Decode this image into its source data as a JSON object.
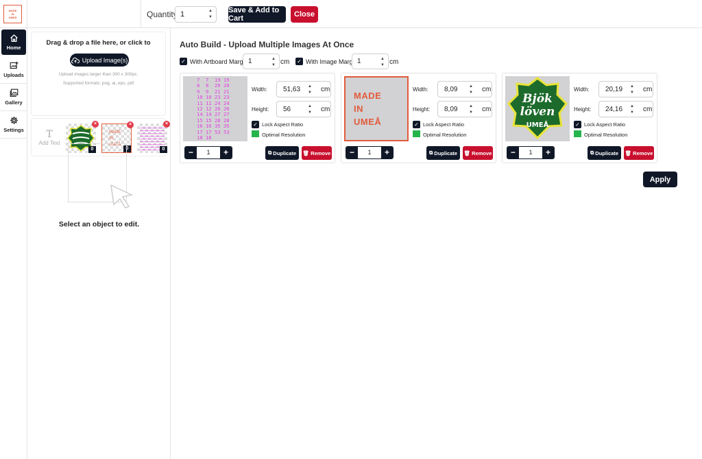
{
  "logo_text": [
    "MADE",
    "IN",
    "UMEÅ"
  ],
  "topbar": {
    "quantity_label": "Quantity:",
    "quantity_value": "1",
    "save_label": "Save & Add to Cart",
    "close_label": "Close"
  },
  "nav": {
    "home": "Home",
    "uploads": "Uploads",
    "gallery": "Gallery",
    "settings": "Settings"
  },
  "upload": {
    "drag_text": "Drag & drop a file here, or click to",
    "button_label": "Upload Image(s)",
    "hint_size": "Upload images larger than 300 x 300px.",
    "hint_formats": "Supported formats: png, ai, eps, pdf"
  },
  "thumbs": {
    "add_text": "Add Text",
    "t_icon": "T",
    "items": [
      {
        "count": "0",
        "text": ""
      },
      {
        "count": "0",
        "text": "MADE\nIN\nUMEÅ"
      },
      {
        "count": "0",
        "text": ""
      }
    ]
  },
  "editor": {
    "select_text": "Select an object to edit."
  },
  "main": {
    "title": "Auto Build - Upload Multiple Images At Once",
    "artboard_margin_label": "With Artboard Margin",
    "artboard_margin_value": "1",
    "image_margin_label": "With Image Margin",
    "image_margin_value": "1",
    "unit": "cm",
    "apply_label": "Apply"
  },
  "cards": [
    {
      "width": "51,63",
      "height": "56",
      "qty": "1"
    },
    {
      "width": "8,09",
      "height": "8,09",
      "qty": "1",
      "image_text": [
        "MADE",
        "IN",
        "UMEÅ"
      ]
    },
    {
      "width": "20,19",
      "height": "24,16",
      "qty": "1",
      "image_text": [
        "Bjök",
        "löven",
        "UMEÅ"
      ]
    }
  ],
  "card_labels": {
    "width": "Width:",
    "height": "Height:",
    "lock": "Lock Aspect Ratio",
    "optimal": "Optimal Resolution",
    "duplicate": "Duplicate",
    "remove": "Remove",
    "minus": "−",
    "plus": "+"
  },
  "pink_numbers": "7  7  19 19\n8  8  20 20\n9  9  21 21\n10 10 23 23\n11 11 24 24\n12 12 26 26\n14 14 27 27\n15 15 28 28\n16 16 35 35\n17 17 53 53\n18 18",
  "colors": {
    "dark": "#101828",
    "red": "#c8102e",
    "green": "#26b44c",
    "brand": "#e25b3b",
    "pink": "#e040e0"
  }
}
